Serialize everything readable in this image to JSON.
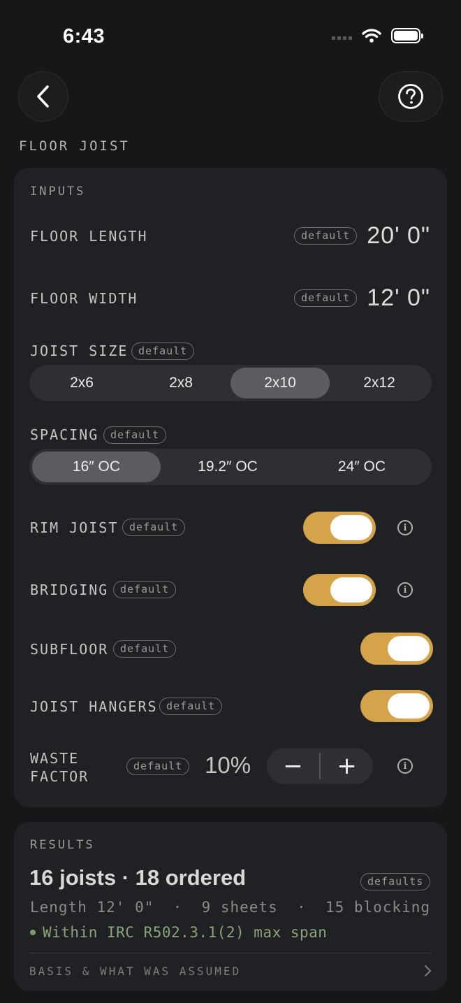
{
  "status_bar": {
    "time": "6:43"
  },
  "header": {
    "title": "FLOOR JOIST"
  },
  "inputs": {
    "section_label": "INPUTS",
    "floor_length": {
      "label": "FLOOR LENGTH",
      "badge": "default",
      "value": "20' 0\""
    },
    "floor_width": {
      "label": "FLOOR WIDTH",
      "badge": "default",
      "value": "12' 0\""
    },
    "joist_size": {
      "label": "JOIST SIZE",
      "badge": "default",
      "options": [
        "2x6",
        "2x8",
        "2x10",
        "2x12"
      ],
      "selected": "2x10"
    },
    "spacing": {
      "label": "SPACING",
      "badge": "default",
      "options": [
        "16″ OC",
        "19.2″ OC",
        "24″ OC"
      ],
      "selected": "16″ OC"
    },
    "rim_joist": {
      "label": "RIM JOIST",
      "badge": "default",
      "on": true
    },
    "bridging": {
      "label": "BRIDGING",
      "badge": "default",
      "on": true
    },
    "subfloor": {
      "label": "SUBFLOOR",
      "badge": "default",
      "on": true
    },
    "joist_hangers": {
      "label": "JOIST HANGERS",
      "badge": "default",
      "on": true
    },
    "waste_factor": {
      "label_line1": "WASTE",
      "label_line2": "FACTOR",
      "badge": "default",
      "value": "10%",
      "minus": "−",
      "plus": "+"
    }
  },
  "results": {
    "section_label": "RESULTS",
    "headline": "16 joists · 18 ordered",
    "badge": "defaults",
    "summary": "Length 12' 0\"  ·  9 sheets  ·  15 blocking",
    "compliance": "Within IRC R502.3.1(2) max span",
    "basis_label": "BASIS & WHAT WAS ASSUMED"
  },
  "colors": {
    "accent": "#d4a34a",
    "ok": "#7e9b6b",
    "card": "#202124",
    "background": "#161719"
  }
}
